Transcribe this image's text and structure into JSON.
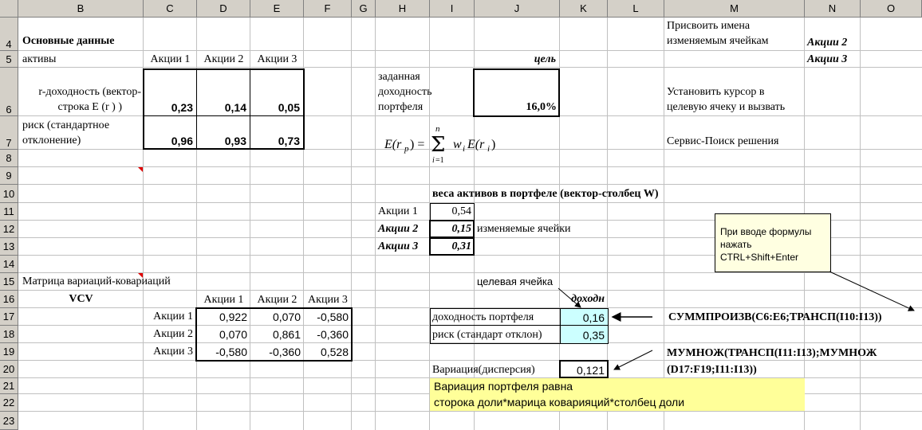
{
  "columns": [
    "B",
    "C",
    "D",
    "E",
    "F",
    "G",
    "H",
    "I",
    "J",
    "K",
    "L",
    "M",
    "N",
    "O"
  ],
  "rows": [
    "4",
    "5",
    "6",
    "7",
    "8",
    "9",
    "10",
    "11",
    "12",
    "13",
    "14",
    "15",
    "16",
    "17",
    "18",
    "19",
    "20",
    "21",
    "22",
    "23"
  ],
  "basic": {
    "title": "Основные данные",
    "assets_label": "активы",
    "stocks": [
      "Акции 1",
      "Акции 2",
      "Акции 3"
    ],
    "return_label_1": "r-доходность (вектор-",
    "return_label_2": "строка E (r )  )",
    "returns": [
      "0,23",
      "0,14",
      "0,05"
    ],
    "risk_label_1": "риск (стандартное",
    "risk_label_2": "отклонение)",
    "risks": [
      "0,96",
      "0,93",
      "0,73"
    ]
  },
  "target": {
    "label": "цель",
    "desc_1": "заданная",
    "desc_2": "доходность",
    "desc_3": "портфеля",
    "value": "16,0%",
    "formula": "E(r_p) = Σ w_i E(r_i)"
  },
  "instructions": {
    "assign_1": "Присвоить имена",
    "assign_2": "изменяемым ячейкам",
    "name_2": "Акции 2",
    "name_3": "Акции 3",
    "cursor_1": "Установить курсор в",
    "cursor_2": "целевую ячеку и вызвать",
    "solver": "Сервис-Поиск решения"
  },
  "weights": {
    "title": "веса активов в портфеле (вектор-столбец W)",
    "labels": [
      "Акции 1",
      "Акции 2",
      "Акции 3"
    ],
    "values": [
      "0,54",
      "0,15",
      "0,31"
    ],
    "changeable": "изменяемые ячейки"
  },
  "note": {
    "line1": "При вводе формулы",
    "line2": "нажать",
    "line3": "CTRL+Shift+Enter"
  },
  "vcv": {
    "title": "Матрица вариаций-ковариаций",
    "label": "VCV",
    "headers": [
      "Акции 1",
      "Акции 2",
      "Акции 3"
    ],
    "rows": [
      {
        "name": "Акции 1",
        "vals": [
          "0,922",
          "0,070",
          "-0,580"
        ]
      },
      {
        "name": "Акции 2",
        "vals": [
          "0,070",
          "0,861",
          "-0,360"
        ]
      },
      {
        "name": "Акции 3",
        "vals": [
          "-0,580",
          "-0,360",
          "0,528"
        ]
      }
    ]
  },
  "results": {
    "target_cell": "целевая ячейка",
    "header": "доходн",
    "ret_label": "доходность портфеля",
    "ret_value": "0,16",
    "risk_label": "риск (стандарт отклон)",
    "risk_value": "0,35",
    "var_label": "Вариация(дисперсия)",
    "var_value": "0,121",
    "formula_1": "СУММПРОИЗВ(C6:E6;ТРАНСП(I10:I13))",
    "formula_2a": "МУМНОЖ(ТРАНСП(I11:I13);МУМНОЖ",
    "formula_2b": "(D17:F19;I11:I13))",
    "explain_1": "Вариация портфеля равна",
    "explain_2": "сторока доли*марица коварияций*столбец доли"
  }
}
